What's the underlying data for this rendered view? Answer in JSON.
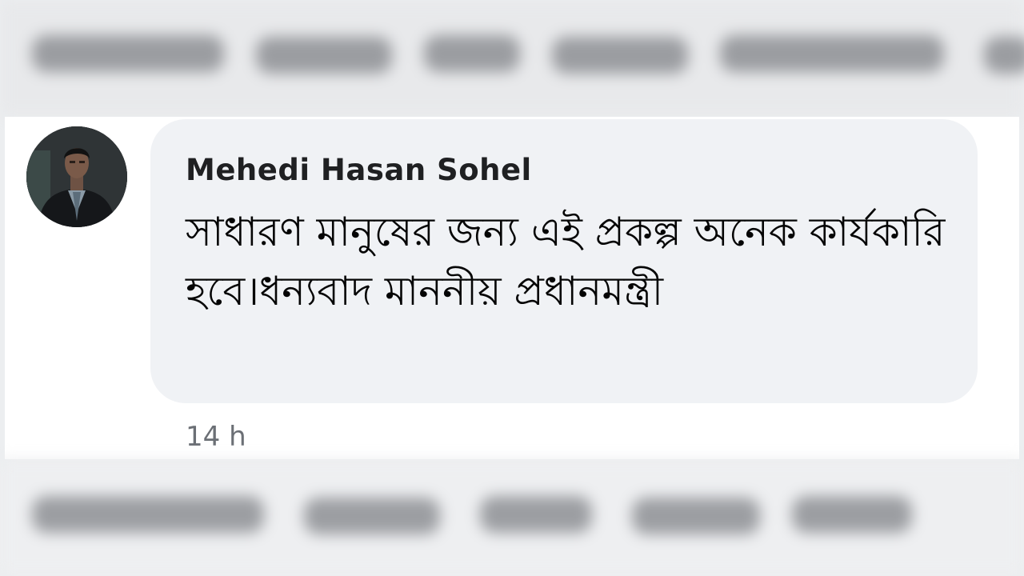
{
  "comment": {
    "author": "Mehedi Hasan Sohel",
    "text": "সাধারণ মানুষের জন্য এই প্রকল্প অনেক কার্যকারি হবে।ধন্যবাদ মাননীয় প্রধানমন্ত্রী",
    "timestamp": "14 h",
    "avatar_icon": "profile-photo-icon"
  },
  "colors": {
    "bubble_background": "#f0f2f5",
    "author_text": "#1f2022",
    "timestamp_text": "#6b6f75",
    "page_background": "#ffffff"
  }
}
